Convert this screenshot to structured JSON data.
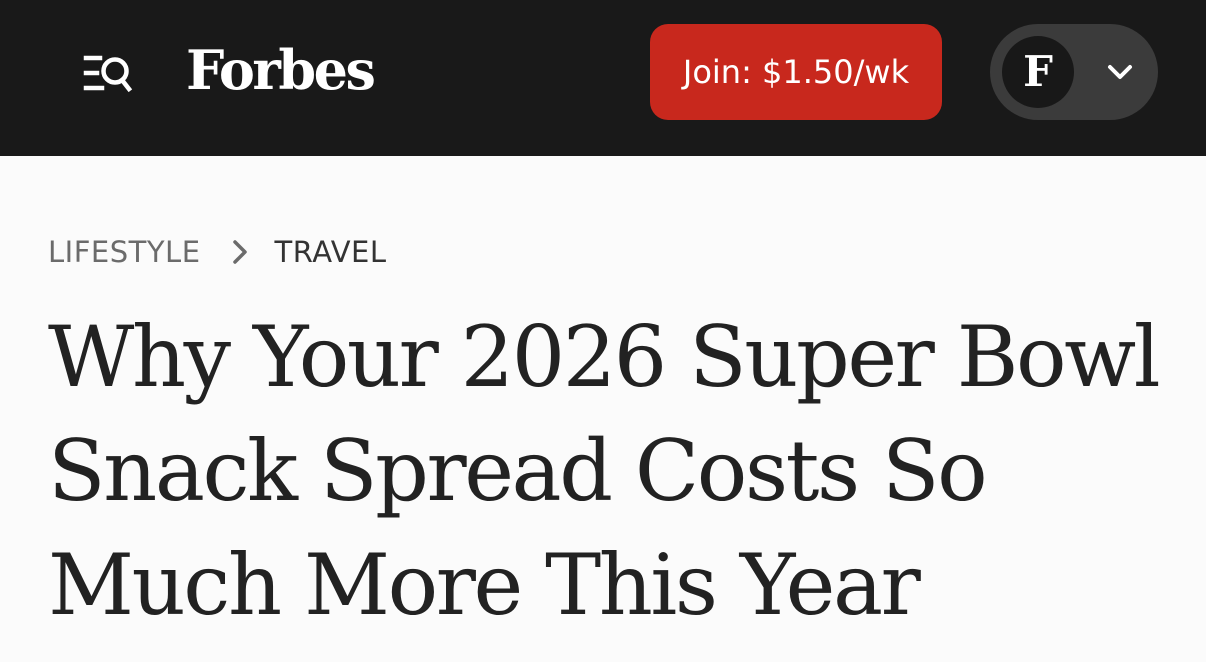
{
  "header": {
    "logo_text": "Forbes",
    "join_label": "Join: $1.50/wk",
    "account_initial": "F",
    "icons": {
      "menu_search": "menu-search-icon",
      "dropdown": "chevron-down-icon"
    }
  },
  "breadcrumb": {
    "items": [
      {
        "label": "LIFESTYLE"
      },
      {
        "label": "TRAVEL"
      }
    ],
    "separator_icon": "chevron-right-icon"
  },
  "article": {
    "headline": "Why Your 2026 Super Bowl Snack Spread Costs So Much More This Year"
  },
  "colors": {
    "header_bg": "#191919",
    "join_button_bg": "#c8281d",
    "account_pill_bg": "#3b3b3b",
    "page_bg": "#fbfbfb",
    "headline_text": "#222222"
  }
}
